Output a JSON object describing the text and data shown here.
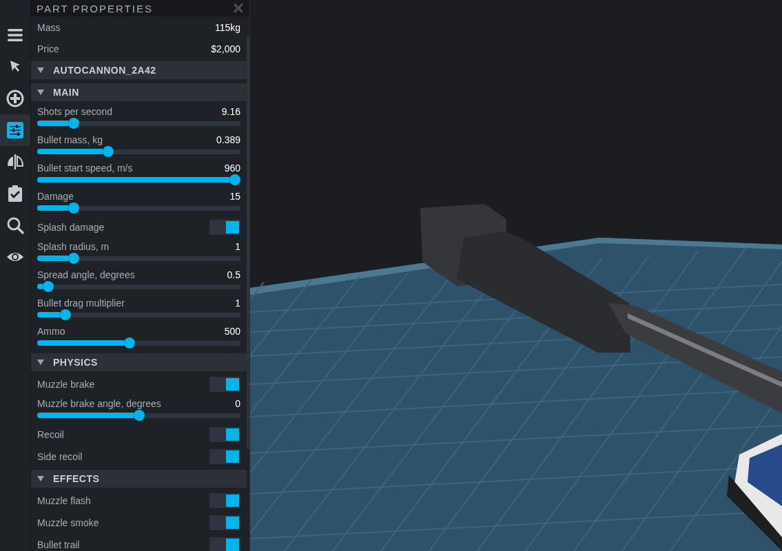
{
  "panel": {
    "title": "PART PROPERTIES",
    "close": "×"
  },
  "toolbar": [
    {
      "selected": false
    },
    {
      "selected": false
    },
    {
      "selected": false
    },
    {
      "selected": true
    },
    {
      "selected": false
    },
    {
      "selected": false
    },
    {
      "selected": false
    },
    {
      "selected": false
    }
  ],
  "rows": [
    {
      "kind": "info",
      "label": "Mass",
      "value": "115kg"
    },
    {
      "kind": "info",
      "label": "Price",
      "value": "$2,000"
    },
    {
      "kind": "section",
      "title": "AUTOCANNON_2A42",
      "expanded": true
    },
    {
      "kind": "section",
      "title": "MAIN",
      "expanded": true
    },
    {
      "kind": "slider",
      "label": "Shots per second",
      "reading": "9.16",
      "level": 0.16
    },
    {
      "kind": "slider",
      "label": "Bullet mass, kg",
      "reading": "0.389",
      "level": 0.34
    },
    {
      "kind": "slider",
      "label": "Bullet start speed, m/s",
      "reading": "960",
      "level": 1
    },
    {
      "kind": "slider",
      "label": "Damage",
      "reading": "15",
      "level": 0.16
    },
    {
      "kind": "toggle",
      "label": "Splash damage",
      "on": true
    },
    {
      "kind": "slider",
      "label": "Splash radius, m",
      "reading": "1",
      "level": 0.16
    },
    {
      "kind": "slider",
      "label": "Spread angle, degrees",
      "reading": "0.5",
      "level": 0.03
    },
    {
      "kind": "slider",
      "label": "Bullet drag multiplier",
      "reading": "1",
      "level": 0.12
    },
    {
      "kind": "slider",
      "label": "Ammo",
      "reading": "500",
      "level": 0.45
    },
    {
      "kind": "section",
      "title": "PHYSICS",
      "expanded": true
    },
    {
      "kind": "toggle",
      "label": "Muzzle brake",
      "on": true
    },
    {
      "kind": "slider",
      "label": "Muzzle brake angle, degrees",
      "reading": "0",
      "level": 0.5
    },
    {
      "kind": "toggle",
      "label": "Recoil",
      "on": true
    },
    {
      "kind": "toggle",
      "label": "Side recoil",
      "on": true
    },
    {
      "kind": "section",
      "title": "EFFECTS",
      "expanded": true
    },
    {
      "kind": "toggle",
      "label": "Muzzle flash",
      "on": true
    },
    {
      "kind": "toggle",
      "label": "Muzzle smoke",
      "on": true
    },
    {
      "kind": "toggle",
      "label": "Bullet trail",
      "on": true
    }
  ]
}
